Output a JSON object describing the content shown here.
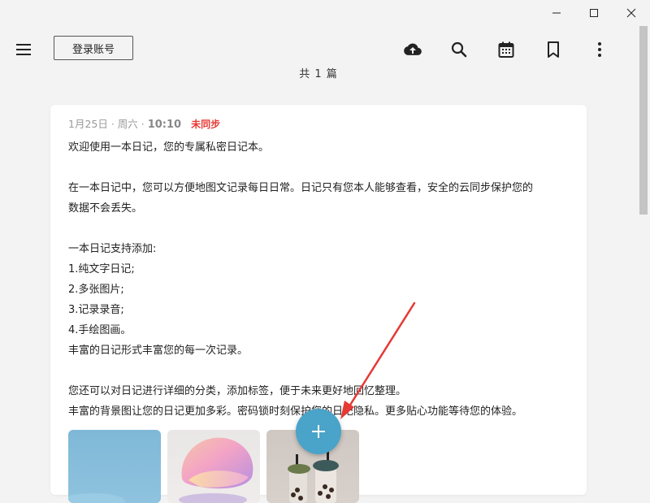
{
  "window": {
    "minimize_icon": "minimize-icon",
    "maximize_icon": "maximize-icon",
    "close_icon": "close-icon"
  },
  "header": {
    "menu_icon": "hamburger-menu-icon",
    "login_label": "登录账号",
    "icons": [
      "cloud-upload-icon",
      "search-icon",
      "calendar-icon",
      "bookmark-icon",
      "more-vertical-icon"
    ]
  },
  "count_text": "共 1 篇",
  "entry": {
    "date": "1月25日 · 周六 · ",
    "time": "10:10",
    "sync_status": "未同步",
    "sync_color": "#e53935",
    "lines": [
      "欢迎使用一本日记，您的专属私密日记本。",
      "",
      "在一本日记中，您可以方便地图文记录每日日常。日记只有您本人能够查看，安全的云同步保护您的",
      "数据不会丢失。",
      "",
      "一本日记支持添加:",
      " 1.纯文字日记;",
      " 2.多张图片;",
      " 3.记录录音;",
      " 4.手绘图画。",
      "丰富的日记形式丰富您的每一次记录。",
      "",
      "您还可以对日记进行详细的分类，添加标签，便于未来更好地回忆整理。",
      "丰富的背景图让您的日记更加多彩。密码锁时刻保护您的日记隐私。更多贴心功能等待您的体验。"
    ]
  },
  "fab": {
    "icon": "plus-icon",
    "color": "#4aa3c8"
  },
  "annotation_color": "#e53935"
}
